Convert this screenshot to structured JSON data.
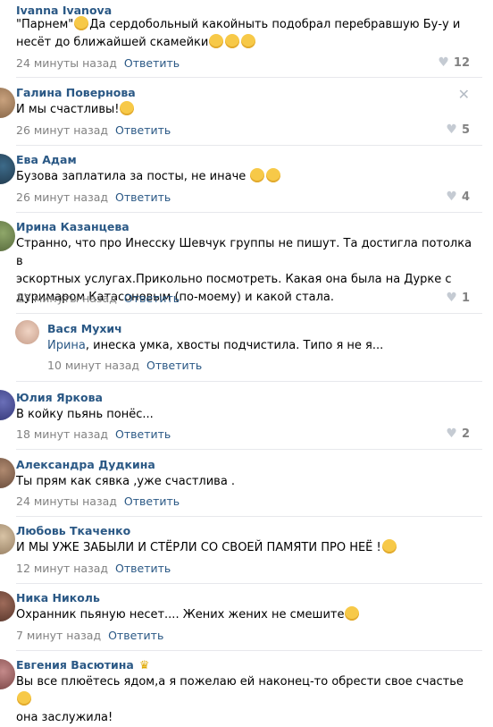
{
  "comments": [
    {
      "author": "Ivanna Ivanova",
      "text_a": "\"Парнем\"",
      "text_b": "Да сердобольный какойныть подобрал перебравшую Бу-у и",
      "text_c": "несёт до ближайшей скамейки",
      "time": "24 минуты назад",
      "reply": "Ответить",
      "likes": "12"
    },
    {
      "author": "Галина Повернова",
      "text": "И мы счастливы!",
      "time": "26 минут назад",
      "reply": "Ответить",
      "likes": "5"
    },
    {
      "author": "Ева Адам",
      "text": "Бузова заплатила за посты, не иначе",
      "time": "26 минут назад",
      "reply": "Ответить",
      "likes": "4"
    },
    {
      "author": "Ирина Казанцева",
      "text_1": "Странно, что про Инесску Шевчук группы не пишут. Та достигла потолка в",
      "text_2": "эскортных услугах.Прикольно посмотреть. Какая она была на Дурке с",
      "text_3": "дуримаром Катасоновым (по-моему) и какой стала.",
      "time": "23 минуты назад",
      "reply": "Ответить",
      "likes": "1"
    },
    {
      "author": "Вася Мухич",
      "mention": "Ирина",
      "text": ", инеска умка, хвосты подчистила. Типо я не я...",
      "time": "10 минут назад",
      "reply": "Ответить"
    },
    {
      "author": "Юлия Яркова",
      "text": "В койку пьянь понёс...",
      "time": "18 минут назад",
      "reply": "Ответить",
      "likes": "2"
    },
    {
      "author": "Александра Дудкина",
      "text": "Ты прям как сявка ,уже счастлива .",
      "time": "24 минуты назад",
      "reply": "Ответить"
    },
    {
      "author": "Любовь Ткаченко",
      "text": "И МЫ УЖЕ ЗАБЫЛИ И СТЁРЛИ СО СВОЕЙ ПАМЯТИ ПРО НЕЁ !",
      "time": "12 минут назад",
      "reply": "Ответить"
    },
    {
      "author": "Ника Николь",
      "text": "Охранник пьяную несет.... Жених жених не смешите",
      "time": "7 минут назад",
      "reply": "Ответить"
    },
    {
      "author": "Евгения Васютина",
      "text_1": "Вы все плюётесь ядом,а я пожелаю ей наконец-то обрести свое счастье",
      "text_2": "она заслужила!"
    }
  ],
  "icons": {
    "heart": "heart-icon",
    "close": "close-icon",
    "crown": "crown-icon",
    "emoji": "emoji-icon"
  },
  "colors": {
    "link": "#2a5885",
    "meta": "#828282",
    "divider": "#e7e8ec"
  }
}
